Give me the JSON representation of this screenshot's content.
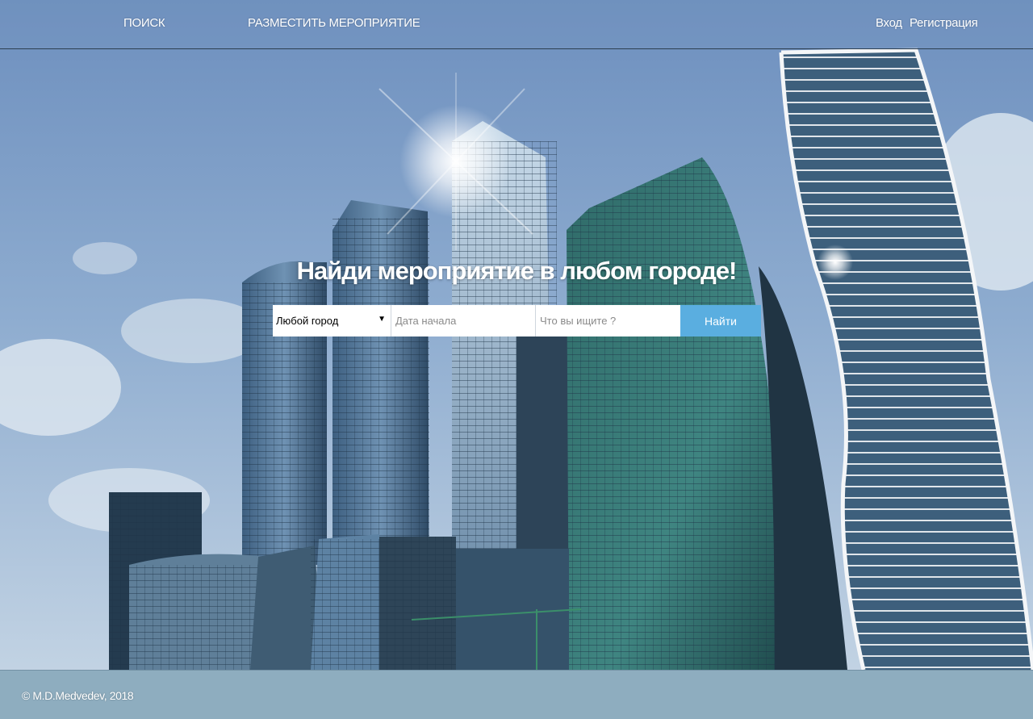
{
  "nav": {
    "search_label": "ПОИСК",
    "post_event_label": "РАЗМЕСТИТЬ МЕРОПРИЯТИЕ",
    "login_label": "Вход",
    "register_label": "Регистрация"
  },
  "hero": {
    "title": "Найди мероприятие в любом городе!"
  },
  "search": {
    "city_selected": "Любой город",
    "date_placeholder": "Дата начала",
    "query_placeholder": "Что вы ищите ?",
    "button_label": "Найти"
  },
  "footer": {
    "copyright": "© M.D.Medvedev, 2018"
  },
  "colors": {
    "accent_button": "#5aaee0",
    "sky": "#7f9fc4",
    "header_border": "#2c3e50"
  },
  "icons": {
    "select_arrow": "triangle-down"
  }
}
